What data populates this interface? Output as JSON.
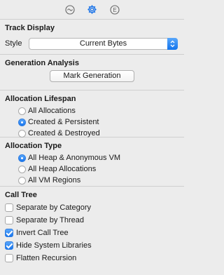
{
  "toolbar": {
    "tabs": [
      {
        "icon": "waveform-icon",
        "selected": false
      },
      {
        "icon": "gear-icon",
        "selected": true
      },
      {
        "icon": "extended-info-icon",
        "selected": false,
        "glyph": "E"
      }
    ]
  },
  "track_display": {
    "title": "Track Display",
    "style_label": "Style",
    "style_value": "Current Bytes"
  },
  "generation_analysis": {
    "title": "Generation Analysis",
    "button_label": "Mark Generation"
  },
  "allocation_lifespan": {
    "title": "Allocation Lifespan",
    "options": [
      {
        "label": "All Allocations",
        "selected": false
      },
      {
        "label": "Created & Persistent",
        "selected": true
      },
      {
        "label": "Created & Destroyed",
        "selected": false
      }
    ]
  },
  "allocation_type": {
    "title": "Allocation Type",
    "options": [
      {
        "label": "All Heap & Anonymous VM",
        "selected": true
      },
      {
        "label": "All Heap Allocations",
        "selected": false
      },
      {
        "label": "All VM Regions",
        "selected": false
      }
    ]
  },
  "call_tree": {
    "title": "Call Tree",
    "options": [
      {
        "label": "Separate by Category",
        "checked": false
      },
      {
        "label": "Separate by Thread",
        "checked": false
      },
      {
        "label": "Invert Call Tree",
        "checked": true
      },
      {
        "label": "Hide System Libraries",
        "checked": true
      },
      {
        "label": "Flatten Recursion",
        "checked": false
      }
    ]
  },
  "colors": {
    "accent": "#1a73e8",
    "background": "#ececec",
    "separator": "#cfcfcf"
  }
}
